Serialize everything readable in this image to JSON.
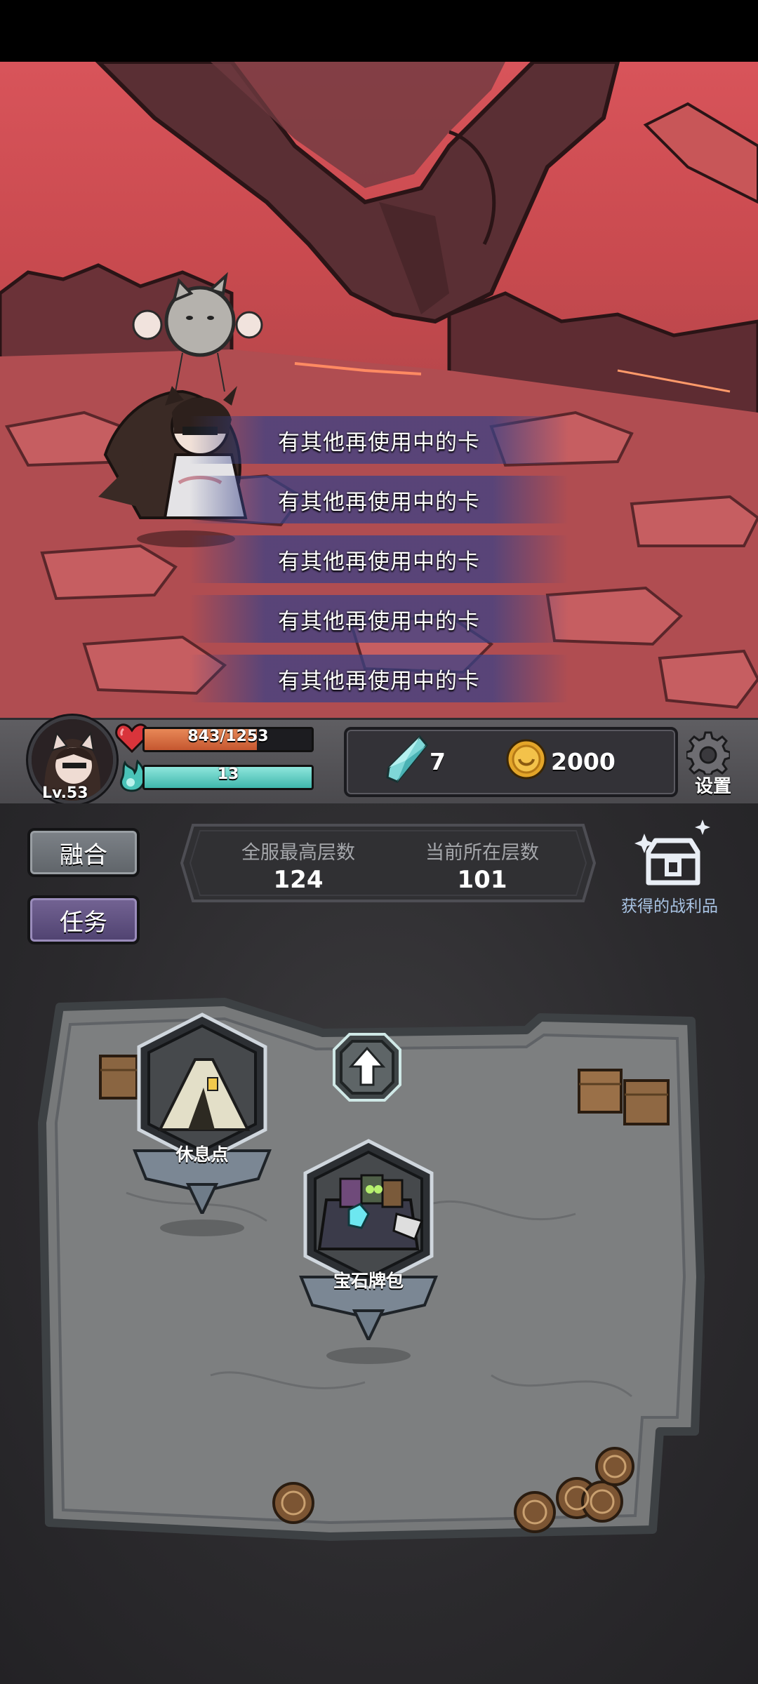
{
  "toasts": [
    "有其他再使用中的卡",
    "有其他再使用中的卡",
    "有其他再使用中的卡",
    "有其他再使用中的卡",
    "有其他再使用中的卡"
  ],
  "player": {
    "level": "Lv.53",
    "hp_text": "843/1253",
    "hp_fraction": 0.673,
    "energy_text": "13",
    "energy_fraction": 1.0
  },
  "resources": {
    "crystal": "7",
    "gold": "2000"
  },
  "settings_label": "设置",
  "side_buttons": {
    "fuse": "融合",
    "tasks": "任务"
  },
  "floors": {
    "server_max_label": "全服最高层数",
    "server_max_value": "124",
    "current_label": "当前所在层数",
    "current_value": "101"
  },
  "loot_label": "获得的战利品",
  "map_nodes": {
    "rest": "休息点",
    "gem_pack": "宝石牌包"
  },
  "colors": {
    "hp": "#d5663b",
    "energy": "#5cc9bf",
    "accent_purple": "#5d4f82"
  }
}
